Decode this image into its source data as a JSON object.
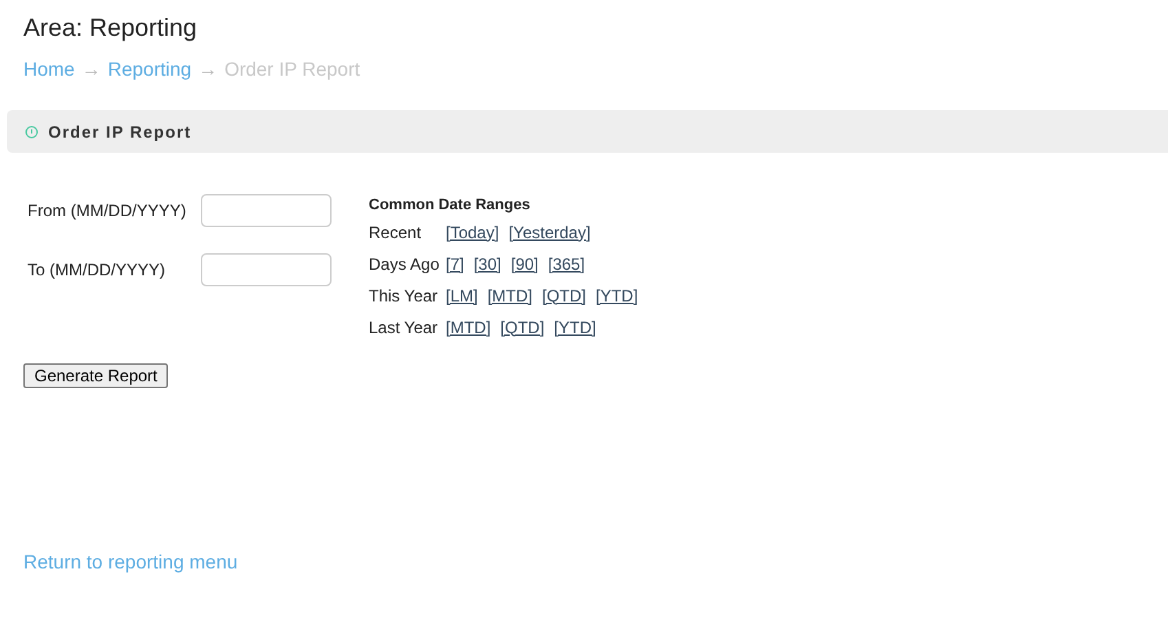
{
  "area_title": "Area: Reporting",
  "breadcrumb": [
    {
      "label": "Home",
      "kind": "link"
    },
    {
      "label": "→",
      "kind": "separator"
    },
    {
      "label": "Reporting",
      "kind": "link"
    },
    {
      "label": "→",
      "kind": "separator"
    },
    {
      "label": "Order IP Report",
      "kind": "current"
    }
  ],
  "panel": {
    "title": "Order IP Report"
  },
  "fields": [
    {
      "label": "From (MM/DD/YYYY)"
    },
    {
      "label": "To (MM/DD/YYYY)"
    }
  ],
  "date_ranges": {
    "title": "Common Date Ranges",
    "rows": [
      {
        "label": "Recent",
        "links": [
          "[Today]",
          "[Yesterday]"
        ]
      },
      {
        "label": "Days Ago",
        "links": [
          "[7]",
          "[30]",
          "[90]",
          "[365]"
        ]
      },
      {
        "label": "This Year",
        "links": [
          "[LM]",
          "[MTD]",
          "[QTD]",
          "[YTD]"
        ]
      },
      {
        "label": "Last Year",
        "links": [
          "[MTD]",
          "[QTD]",
          "[YTD]"
        ]
      }
    ]
  },
  "generate_button": "Generate Report",
  "return_link": "Return to reporting menu"
}
